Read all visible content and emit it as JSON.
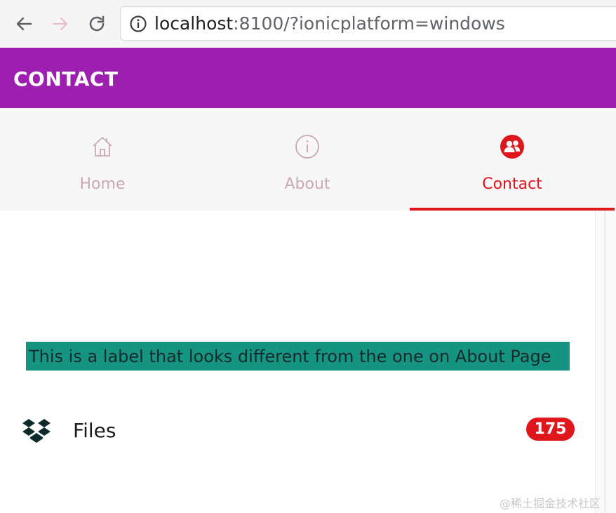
{
  "browser": {
    "url_host": "localhost",
    "url_rest": ":8100/?ionicplatform=windows",
    "icons": {
      "back": "back-arrow-icon",
      "forward": "forward-arrow-icon",
      "reload": "reload-icon",
      "info": "info-icon"
    }
  },
  "header": {
    "title": "CONTACT",
    "color": "#9c1fb0"
  },
  "tabs": [
    {
      "label": "Home",
      "icon": "home-icon",
      "selected": false
    },
    {
      "label": "About",
      "icon": "information-icon",
      "selected": false
    },
    {
      "label": "Contact",
      "icon": "contacts-icon",
      "selected": true
    }
  ],
  "accent_color": "#e0161d",
  "content": {
    "label_text": "This is a label that looks different from the one on About Page",
    "label_bg": "#169482",
    "files": {
      "icon": "dropbox-icon",
      "label": "Files",
      "badge": "175"
    }
  },
  "watermark": "@稀土掘金技术社区"
}
